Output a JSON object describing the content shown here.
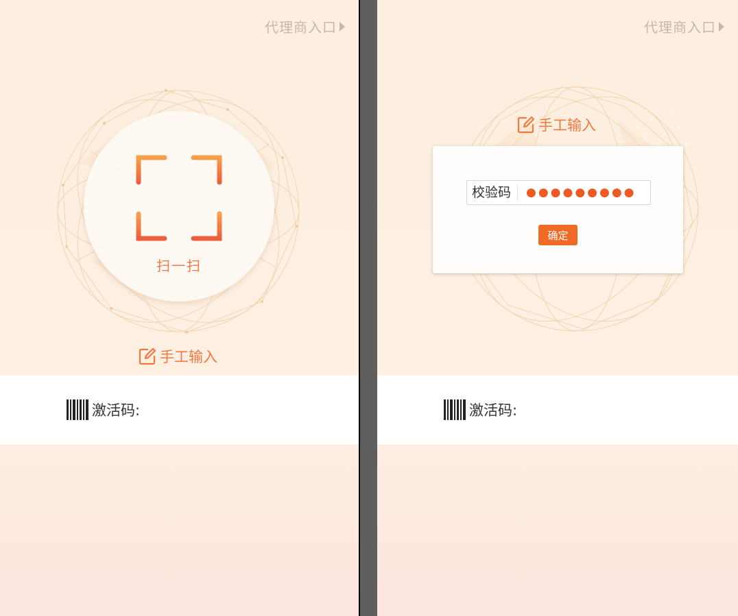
{
  "left_screen": {
    "agent_entry": "代理商入口",
    "scan_label": "扫一扫",
    "manual_input": "手工输入",
    "activation_label": "激活码:"
  },
  "right_screen": {
    "agent_entry": "代理商入口",
    "manual_input": "手工输入",
    "dialog": {
      "field_label": "校验码",
      "field_value": "●●●●●●●●●",
      "confirm_button": "确定"
    },
    "activation_label": "激活码:"
  },
  "icons": {
    "agent_arrow": "caret-right-icon",
    "scan": "scan-icon",
    "manual": "edit-icon",
    "barcode": "barcode-icon"
  },
  "colors": {
    "accent": "#ef7a3f",
    "button": "#ef6a26",
    "agent_text": "#c8b6a8",
    "background_top": "#fdefe0",
    "background_bottom": "#fde6e0"
  }
}
